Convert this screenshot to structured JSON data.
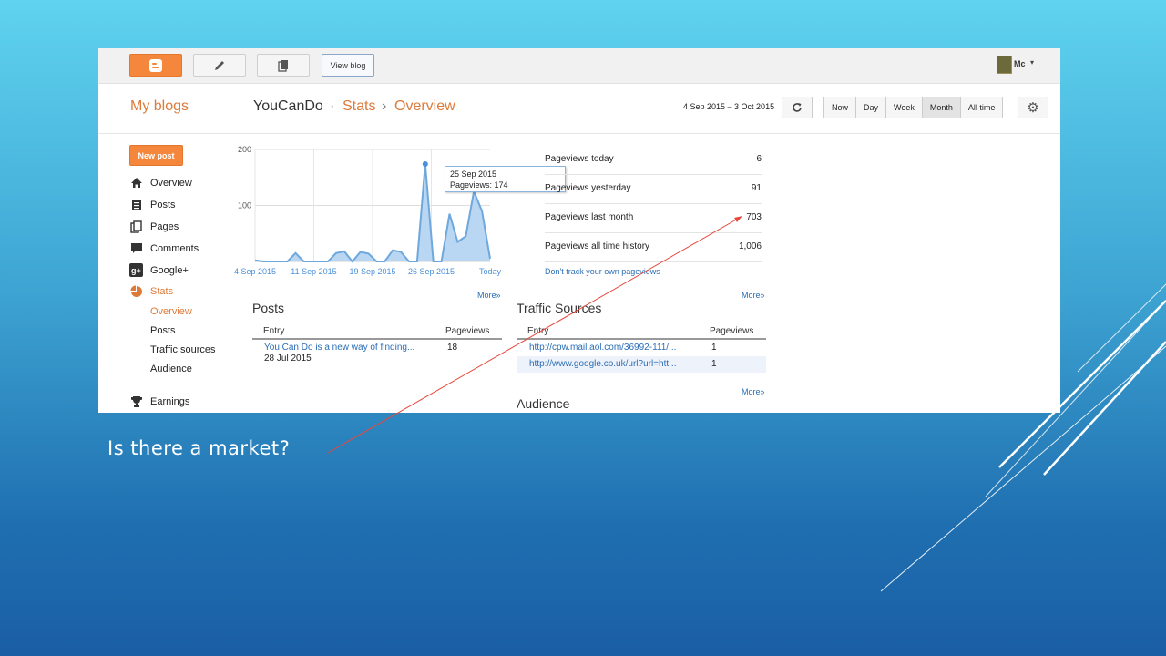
{
  "slide": {
    "caption": "Is there a market?"
  },
  "topbar": {
    "view_blog_label": "View blog",
    "user_name": "Mc",
    "user_caret": "▾"
  },
  "header": {
    "my_blogs": "My blogs",
    "blog_name": "YouCanDo",
    "separator": "·",
    "stats": "Stats",
    "arrow": "›",
    "overview": "Overview",
    "date_range": "4 Sep 2015 – 3 Oct 2015",
    "ranges": [
      {
        "label": "Now",
        "active": false
      },
      {
        "label": "Day",
        "active": false
      },
      {
        "label": "Week",
        "active": false
      },
      {
        "label": "Month",
        "active": true
      },
      {
        "label": "All time",
        "active": false
      }
    ]
  },
  "sidebar": {
    "new_post": "New post",
    "items": [
      {
        "label": "Overview",
        "icon": "home-icon"
      },
      {
        "label": "Posts",
        "icon": "posts-icon"
      },
      {
        "label": "Pages",
        "icon": "pages-icon"
      },
      {
        "label": "Comments",
        "icon": "comments-icon"
      },
      {
        "label": "Google+",
        "icon": "google-plus-icon"
      },
      {
        "label": "Stats",
        "icon": "stats-pie-icon"
      }
    ],
    "stats_sub": [
      "Overview",
      "Posts",
      "Traffic sources",
      "Audience"
    ],
    "earnings": "Earnings"
  },
  "chart_data": {
    "type": "area",
    "y_ticks": [
      "200",
      "100"
    ],
    "ylim": [
      0,
      200
    ],
    "x_labels": [
      "4 Sep 2015",
      "11 Sep 2015",
      "19 Sep 2015",
      "26 Sep 2015",
      "Today"
    ],
    "values": [
      2,
      0,
      0,
      0,
      0,
      15,
      0,
      0,
      0,
      0,
      15,
      18,
      0,
      17,
      14,
      0,
      0,
      20,
      17,
      0,
      0,
      174,
      0,
      0,
      85,
      35,
      45,
      125,
      90,
      5
    ],
    "highlight_index": 21,
    "color": "#6fa8dc",
    "fill": "#b9d6f2",
    "tooltip": {
      "date": "25 Sep 2015",
      "text": "Pageviews: 174"
    }
  },
  "pageviews": {
    "rows": [
      {
        "label": "Pageviews today",
        "value": "6"
      },
      {
        "label": "Pageviews yesterday",
        "value": "91"
      },
      {
        "label": "Pageviews last month",
        "value": "703"
      },
      {
        "label": "Pageviews all time history",
        "value": "1,006"
      }
    ],
    "dont_track": "Don't track your own pageviews"
  },
  "posts_section": {
    "title": "Posts",
    "more": "More»",
    "col_entry": "Entry",
    "col_pageviews": "Pageviews",
    "rows": [
      {
        "entry": "You Can Do is a new way of finding...",
        "date": "28 Jul 2015",
        "pageviews": "18"
      }
    ]
  },
  "traffic_section": {
    "title": "Traffic Sources",
    "more": "More»",
    "col_entry": "Entry",
    "col_pageviews": "Pageviews",
    "rows": [
      {
        "entry": "http://cpw.mail.aol.com/36992-111/...",
        "pageviews": "1"
      },
      {
        "entry": "http://www.google.co.uk/url?url=htt...",
        "pageviews": "1"
      }
    ]
  },
  "audience_section": {
    "title": "Audience",
    "more": "More»"
  },
  "colors": {
    "accent": "#dd7a3a",
    "link": "#2a6db5",
    "annotation_arrow": "#e8483c"
  }
}
